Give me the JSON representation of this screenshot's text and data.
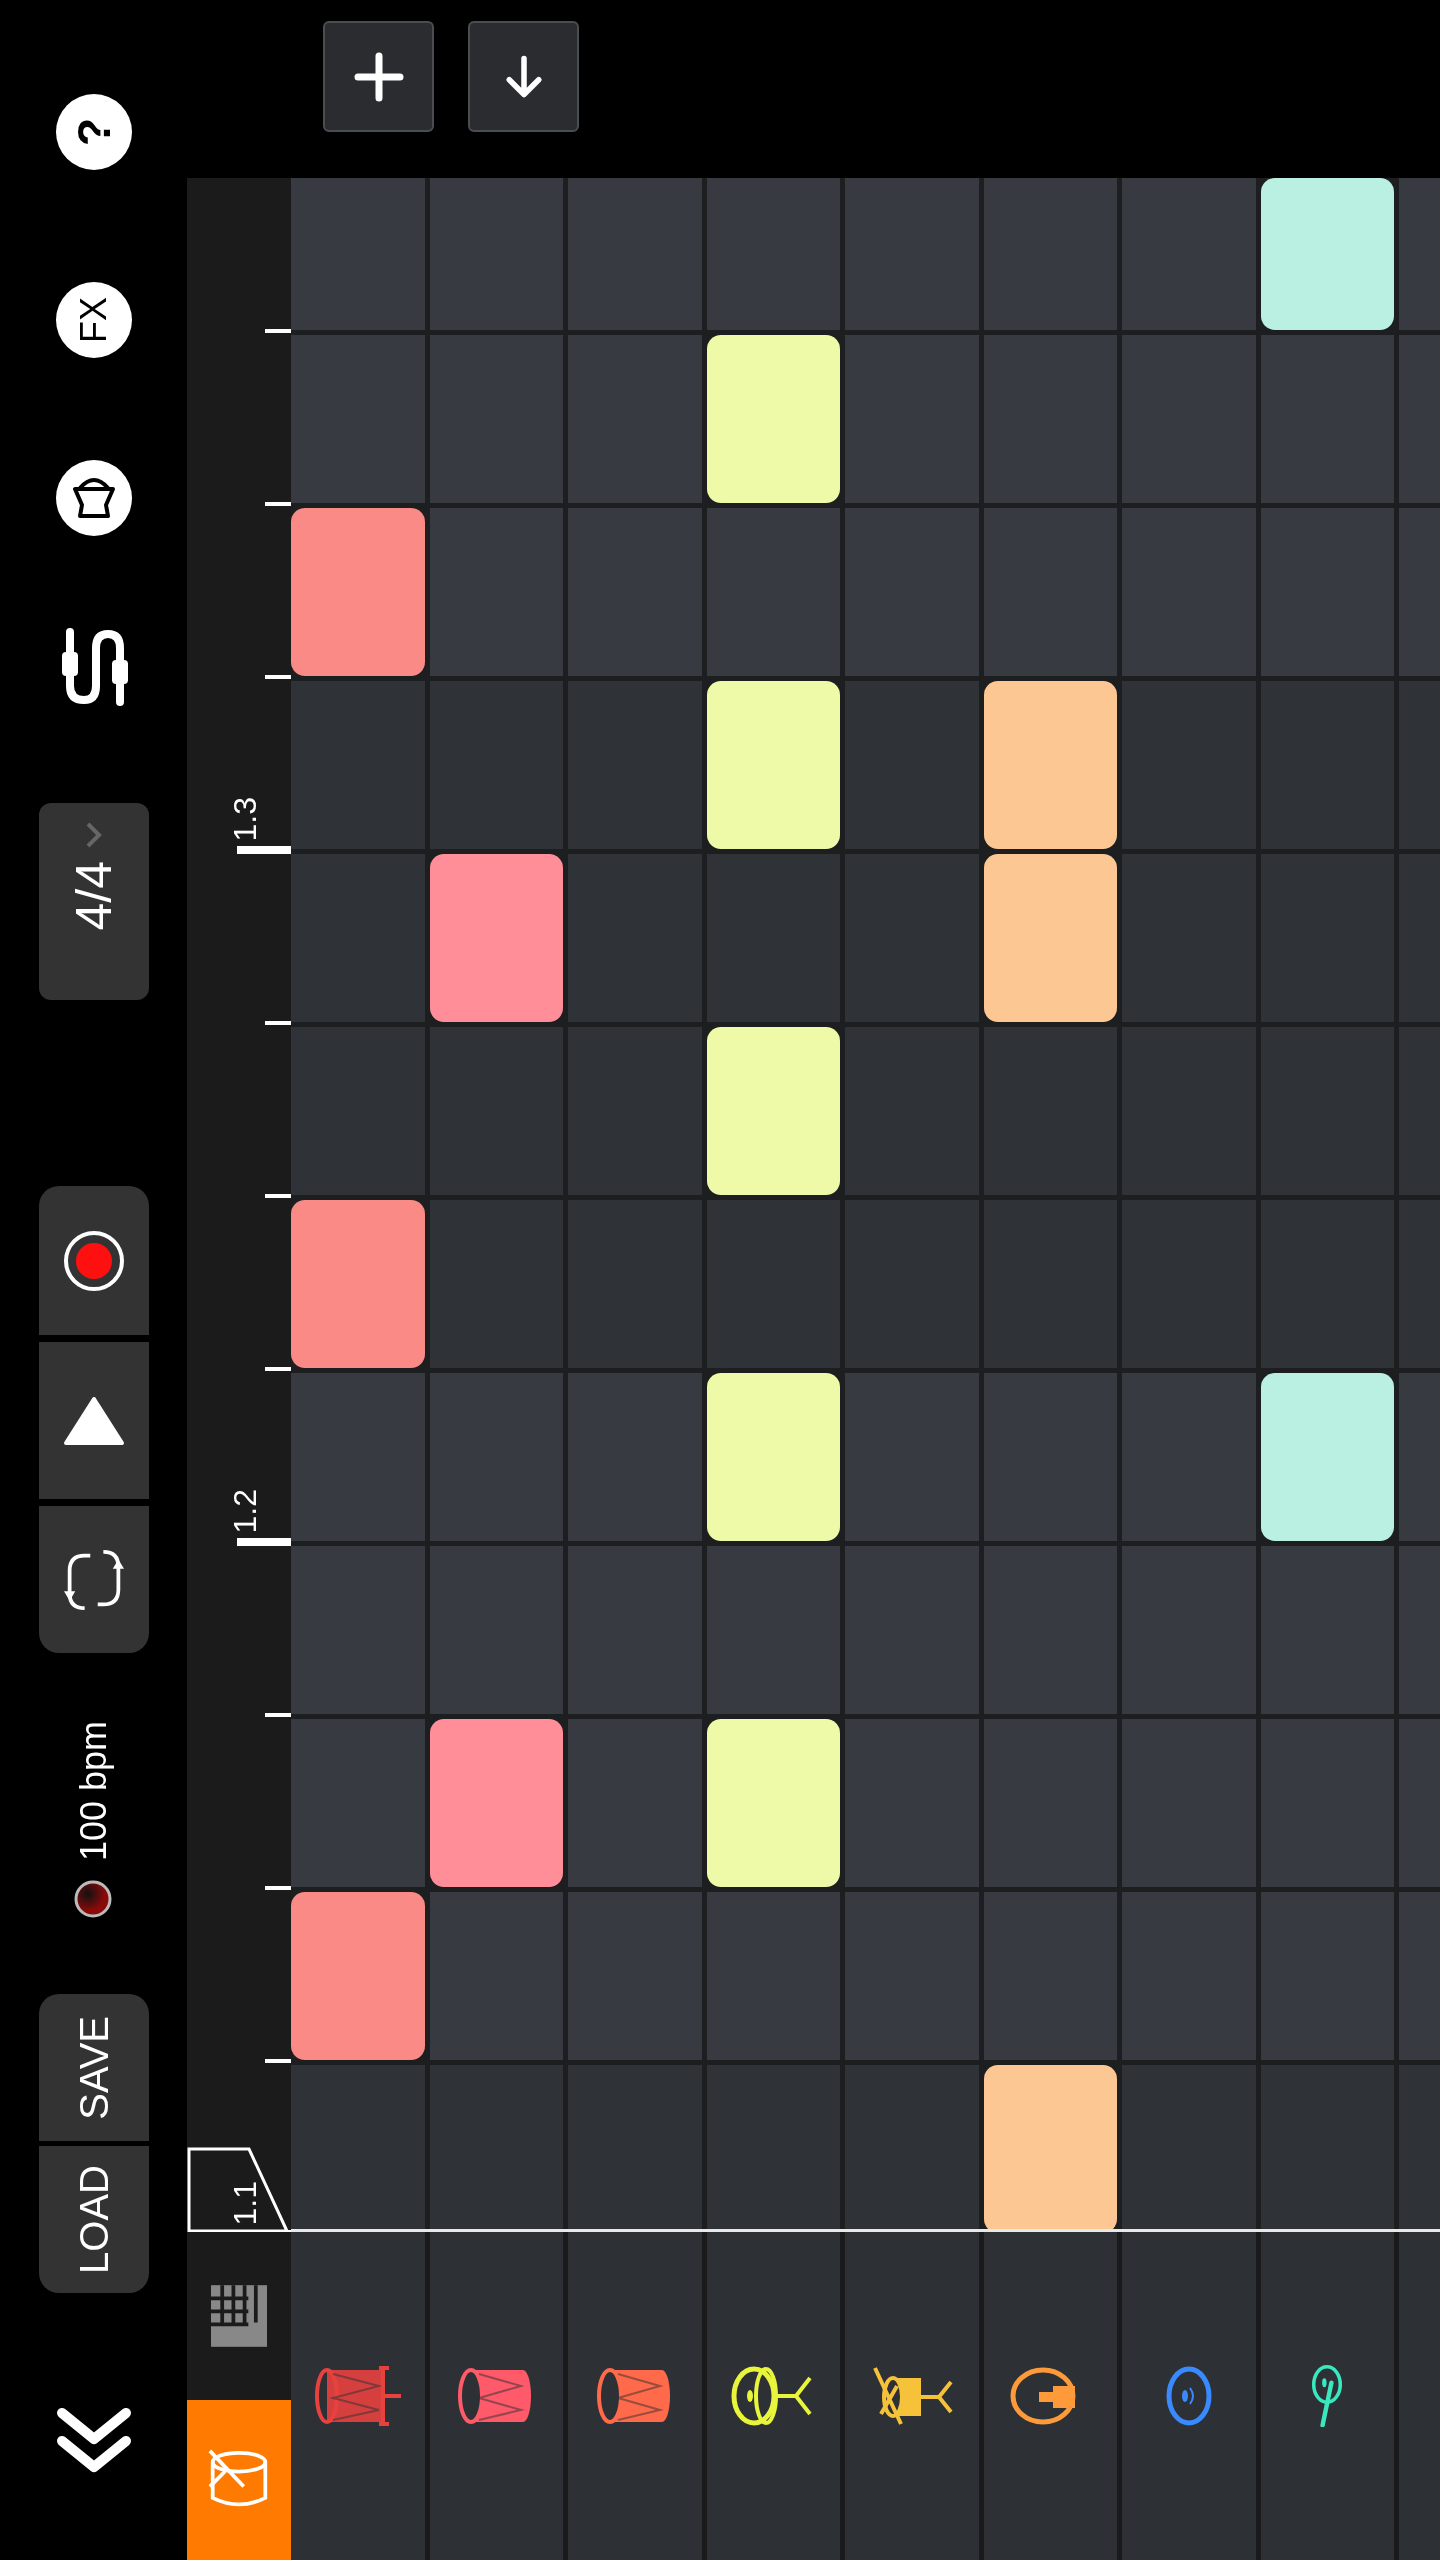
{
  "top_buttons": [
    {
      "kind": "add"
    },
    {
      "kind": "move-down"
    }
  ],
  "sidebar": {
    "help_label": "?",
    "fx_label": "FX",
    "time_signature": "4/4",
    "tempo": "100 bpm",
    "save_label": "SAVE",
    "load_label": "LOAD"
  },
  "rows": [
    {
      "cells": [
        {
          "on": false
        },
        {
          "on": false
        },
        {
          "on": false
        },
        {
          "on": false
        },
        {
          "on": false
        },
        {
          "on": false
        },
        {
          "on": false
        },
        {
          "on": true
        },
        {
          "on": false
        }
      ]
    },
    {
      "cells": [
        {
          "on": false
        },
        {
          "on": false
        },
        {
          "on": false
        },
        {
          "on": true
        },
        {
          "on": false
        },
        {
          "on": false
        },
        {
          "on": false
        },
        {
          "on": false
        },
        {
          "on": false
        }
      ]
    },
    {
      "cells": [
        {
          "on": true
        },
        {
          "on": false
        },
        {
          "on": false
        },
        {
          "on": false
        },
        {
          "on": false
        },
        {
          "on": false
        },
        {
          "on": false
        },
        {
          "on": false
        },
        {
          "on": false
        }
      ]
    },
    {
      "marker": "1.3",
      "cells": [
        {
          "on": false
        },
        {
          "on": false
        },
        {
          "on": false
        },
        {
          "on": true
        },
        {
          "on": false
        },
        {
          "on": true
        },
        {
          "on": false
        },
        {
          "on": false
        },
        {
          "on": false
        }
      ]
    },
    {
      "cells": [
        {
          "on": false
        },
        {
          "on": true
        },
        {
          "on": false
        },
        {
          "on": false
        },
        {
          "on": false
        },
        {
          "on": true
        },
        {
          "on": false
        },
        {
          "on": false
        },
        {
          "on": false
        }
      ]
    },
    {
      "cells": [
        {
          "on": false
        },
        {
          "on": false
        },
        {
          "on": false
        },
        {
          "on": true
        },
        {
          "on": false
        },
        {
          "on": false
        },
        {
          "on": false
        },
        {
          "on": false
        },
        {
          "on": false
        }
      ]
    },
    {
      "cells": [
        {
          "on": true
        },
        {
          "on": false
        },
        {
          "on": false
        },
        {
          "on": false
        },
        {
          "on": false
        },
        {
          "on": false
        },
        {
          "on": false
        },
        {
          "on": false
        },
        {
          "on": false
        }
      ]
    },
    {
      "marker": "1.2",
      "cells": [
        {
          "on": false
        },
        {
          "on": false
        },
        {
          "on": false
        },
        {
          "on": true
        },
        {
          "on": false
        },
        {
          "on": false
        },
        {
          "on": false
        },
        {
          "on": true
        },
        {
          "on": false
        }
      ]
    },
    {
      "cells": [
        {
          "on": false
        },
        {
          "on": false
        },
        {
          "on": false
        },
        {
          "on": false
        },
        {
          "on": false
        },
        {
          "on": false
        },
        {
          "on": false
        },
        {
          "on": false
        },
        {
          "on": false
        }
      ]
    },
    {
      "cells": [
        {
          "on": false
        },
        {
          "on": true
        },
        {
          "on": false
        },
        {
          "on": true
        },
        {
          "on": false
        },
        {
          "on": false
        },
        {
          "on": false
        },
        {
          "on": false
        },
        {
          "on": false
        }
      ]
    },
    {
      "cells": [
        {
          "on": true
        },
        {
          "on": false
        },
        {
          "on": false
        },
        {
          "on": false
        },
        {
          "on": false
        },
        {
          "on": false
        },
        {
          "on": false
        },
        {
          "on": false
        },
        {
          "on": false
        }
      ]
    },
    {
      "cells": [
        {
          "on": false
        },
        {
          "on": false
        },
        {
          "on": false
        },
        {
          "on": false
        },
        {
          "on": false
        },
        {
          "on": true
        },
        {
          "on": false
        },
        {
          "on": false
        },
        {
          "on": false
        }
      ]
    }
  ],
  "playhead": {
    "label": "1.1"
  },
  "tracks": [
    {
      "kind": "bass-drum",
      "color": "#e8423f",
      "note": {
        "color": "#fa8a85"
      }
    },
    {
      "kind": "tom",
      "color": "#ff5a6a",
      "note": {
        "color": "#ff8e98"
      }
    },
    {
      "kind": "tom",
      "color": "#ff6a4a"
    },
    {
      "kind": "hihat",
      "color": "#e8f53a",
      "note": {
        "color": "#eefaa8"
      }
    },
    {
      "kind": "snare",
      "color": "#f5c23a"
    },
    {
      "kind": "bell",
      "color": "#ff9a3a",
      "note": {
        "color": "#fdc794"
      }
    },
    {
      "kind": "cymbal",
      "color": "#3a8aff"
    },
    {
      "kind": "ride",
      "color": "#3ae8c0",
      "note": {
        "color": "#baf0e2"
      }
    },
    {
      "kind": "none"
    }
  ],
  "panel_tabs": [
    {
      "kind": "piano",
      "selected": false
    },
    {
      "kind": "drums",
      "selected": true
    }
  ]
}
